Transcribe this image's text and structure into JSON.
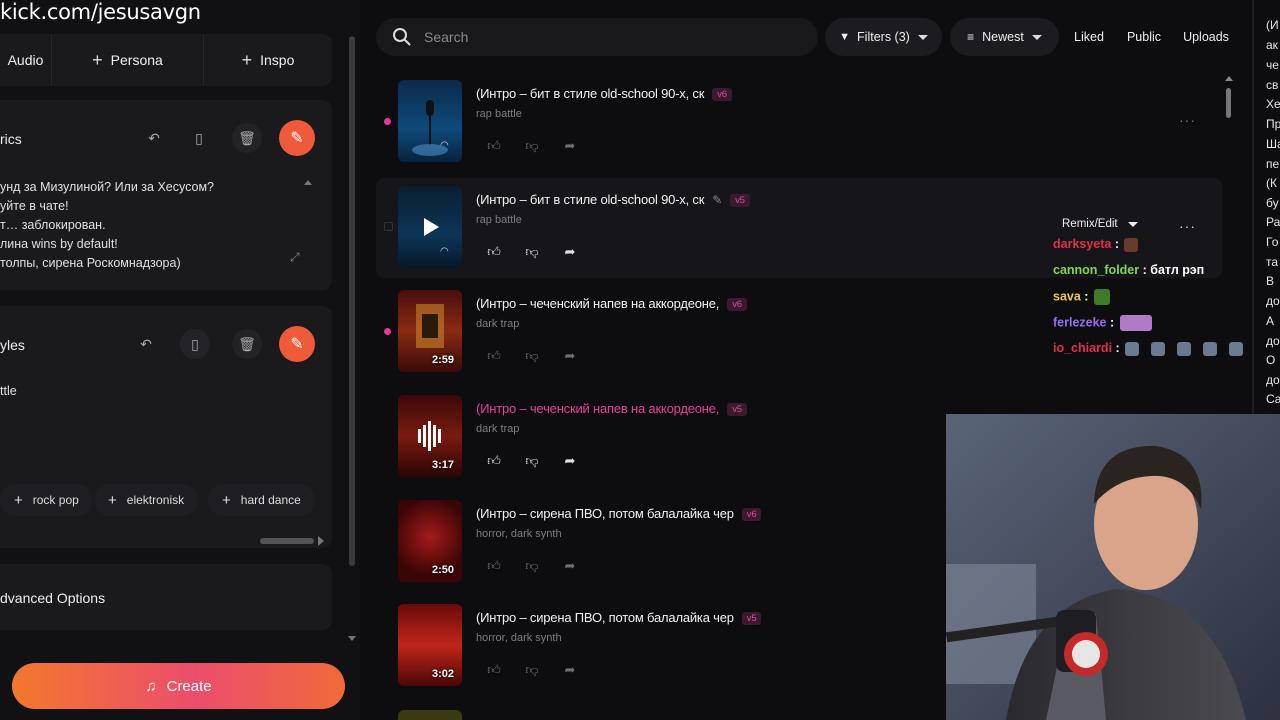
{
  "overlay": {
    "stream_url": "kick.com/jesusavgn"
  },
  "left": {
    "modes": [
      {
        "label": "Audio",
        "plus": false
      },
      {
        "label": "Persona",
        "plus": true
      },
      {
        "label": "Inspo",
        "plus": true
      }
    ],
    "lyrics": {
      "title": "rics",
      "lines": [
        "унд за Мизулиной? Или за Хесусом?",
        "уйте в чате!",
        "т… заблокирован.",
        "лина wins by default!",
        "толпы, сирена Роскомнадзора)"
      ]
    },
    "styles": {
      "title": "yles",
      "value": "ttle",
      "chips": [
        "rock pop",
        "elektronisk",
        "hard dance"
      ]
    },
    "advanced_label": "dvanced Options",
    "create_label": "Create"
  },
  "toolbar": {
    "search_placeholder": "Search",
    "filters_label": "Filters (3)",
    "sort_label": "Newest",
    "liked_label": "Liked",
    "public_label": "Public",
    "uploads_label": "Uploads"
  },
  "tracks": [
    {
      "title": "(Интро – бит в стиле old-school 90-х, ск",
      "version": "v6",
      "genre": "rap battle",
      "duration": "",
      "pink": false,
      "dot": true
    },
    {
      "title": "(Интро – бит в стиле old-school 90-х, ск",
      "version": "v5",
      "genre": "rap battle",
      "duration": "",
      "pink": false,
      "dot": false,
      "remix_label": "Remix/Edit"
    },
    {
      "title": "(Интро – чеченский напев на аккордеоне,",
      "version": "v6",
      "genre": "dark trap",
      "duration": "2:59",
      "pink": false,
      "dot": true
    },
    {
      "title": "(Интро – чеченский напев на аккордеоне,",
      "version": "v5",
      "genre": "dark trap",
      "duration": "3:17",
      "pink": true,
      "dot": false
    },
    {
      "title": "(Интро – сирена ПВО, потом балалайка чер",
      "version": "v6",
      "genre": "horror, dark synth",
      "duration": "2:50",
      "pink": false,
      "dot": false
    },
    {
      "title": "(Интро – сирена ПВО, потом балалайка чер",
      "version": "v5",
      "genre": "horror, dark synth",
      "duration": "3:02",
      "pink": false,
      "dot": false
    }
  ],
  "chat": [
    {
      "user": "darksyeta",
      "color": "#e0304a",
      "msg": ""
    },
    {
      "user": "cannon_folder",
      "color": "#7ed957",
      "msg": "батл рэп"
    },
    {
      "user": "sava",
      "color": "#f2c94c",
      "msg": ""
    },
    {
      "user": "ferlezeke",
      "color": "#9b6cf0",
      "msg": ""
    },
    {
      "user": "io_chiardi",
      "color": "#e0304a",
      "msg": ""
    }
  ],
  "side_panel": {
    "lines": [
      "(И",
      "ак",
      "че",
      "св",
      "Хе",
      "Пр",
      "Ша",
      "пе",
      "(К",
      "бу",
      "Ра",
      "Го",
      "та",
      "В",
      "до",
      "А",
      "до",
      "О",
      "до",
      "Са"
    ]
  },
  "colors": {
    "accent": "#ef5a3a",
    "pink": "#e6409a"
  }
}
